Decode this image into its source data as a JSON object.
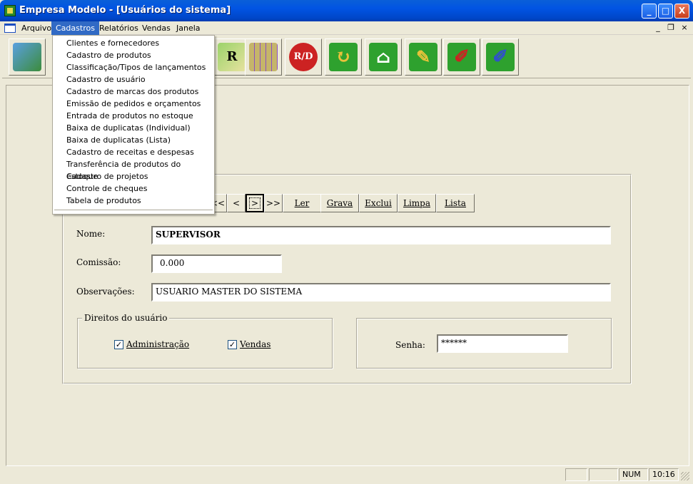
{
  "window": {
    "title": "Empresa Modelo - [Usuários do sistema]",
    "minimize_glyph": "_",
    "maximize_glyph": "□",
    "close_glyph": "X"
  },
  "menubar": {
    "items": [
      "Arquivo",
      "Cadastros",
      "Relatórios",
      "Vendas",
      "Janela"
    ],
    "active": "Cadastros",
    "mdi_minimize": "_",
    "mdi_restore": "❐",
    "mdi_close": "×"
  },
  "toolbar": {
    "icons": [
      "map-icon",
      "notebook-icon",
      "report-icon",
      "spreadsheet-icon",
      "rd-icon",
      "refresh-icon",
      "home-icon",
      "pen-icon",
      "edit-icon",
      "edit-alt-icon"
    ],
    "report_glyph": "R",
    "rd_glyph": "R/D",
    "colors": {
      "green": "#2ea12e",
      "purple": "#8a4fc5",
      "red": "#cc2222",
      "yellow": "#e8c23a"
    }
  },
  "dropdown": {
    "items": [
      "Clientes e fornecedores",
      "Cadastro de produtos",
      "Classificação/Tipos de lançamentos",
      "Cadastro de usuário",
      "Cadastro de marcas dos produtos",
      "Emissão de pedidos e orçamentos",
      "Entrada de produtos no estoque",
      "Baixa de duplicatas (Individual)",
      "Baixa de duplicatas (Lista)",
      "Cadastro de receitas e despesas",
      "Transferência de produtos do estoque",
      "Cadastro de projetos",
      "Controle de cheques",
      "Tabela de produtos"
    ]
  },
  "navigator": {
    "first": "<<",
    "prev": "<",
    "next": ">",
    "last": ">>",
    "ler": "Ler",
    "grava": "Grava",
    "exclui": "Exclui",
    "limpa": "Limpa",
    "lista": "Lista"
  },
  "form": {
    "nome_label": "Nome:",
    "nome_value": "SUPERVISOR",
    "comissao_label": "Comissão:",
    "comissao_value": "0.000",
    "observacoes_label": "Observações:",
    "observacoes_value": "USUARIO MASTER DO SISTEMA",
    "direitos_legend": "Direitos do usuário",
    "administracao_label": "Administração",
    "administracao_checked": true,
    "vendas_label": "Vendas",
    "vendas_checked": true,
    "senha_label": "Senha:",
    "senha_value": "******"
  },
  "statusbar": {
    "num": "NUM",
    "time": "10:16"
  }
}
